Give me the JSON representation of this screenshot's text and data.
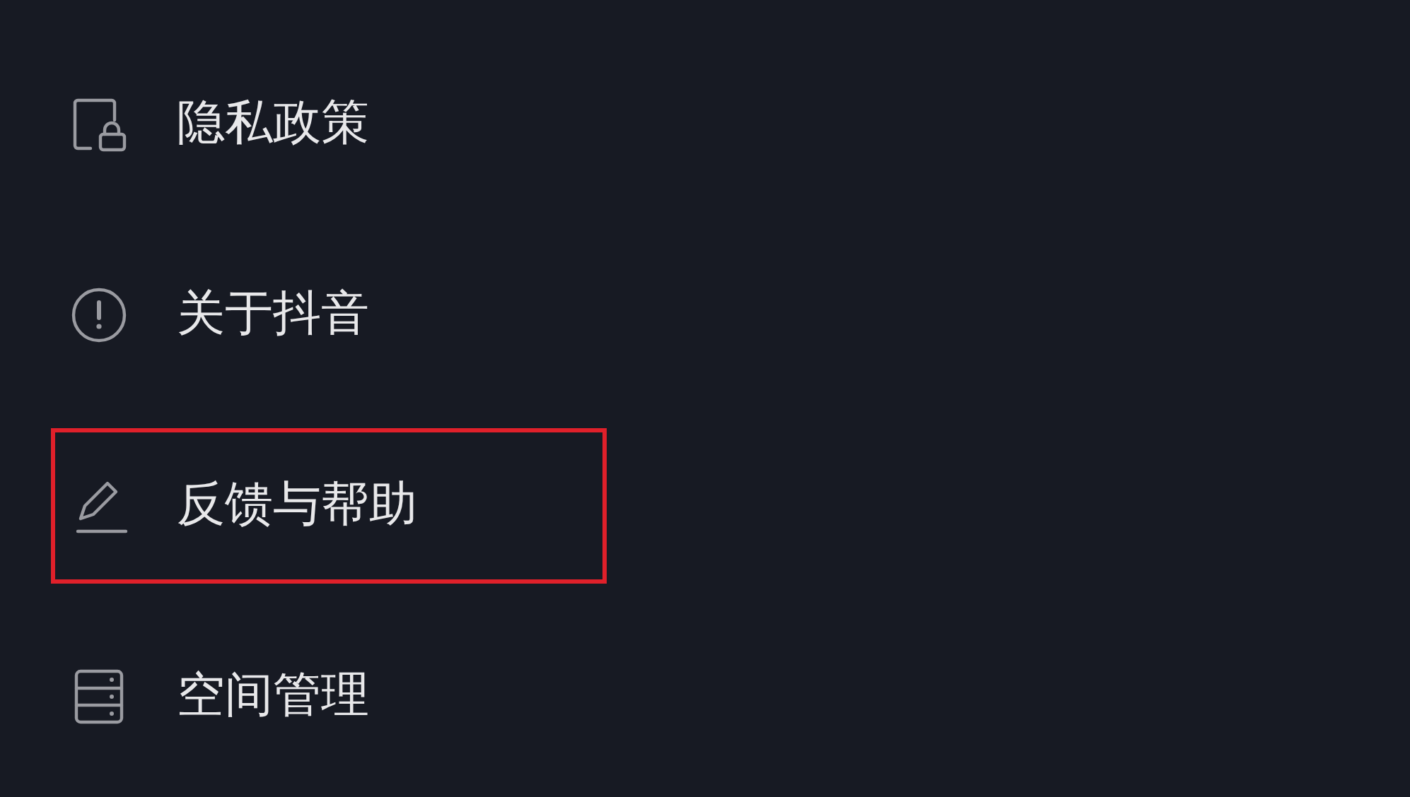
{
  "menu": [
    {
      "kind": "privacy",
      "label": "隐私政策",
      "highlighted": false
    },
    {
      "kind": "about",
      "label": "关于抖音",
      "highlighted": false
    },
    {
      "kind": "feedback",
      "label": "反馈与帮助",
      "highlighted": true
    },
    {
      "kind": "storage",
      "label": "空间管理",
      "highlighted": false
    }
  ]
}
